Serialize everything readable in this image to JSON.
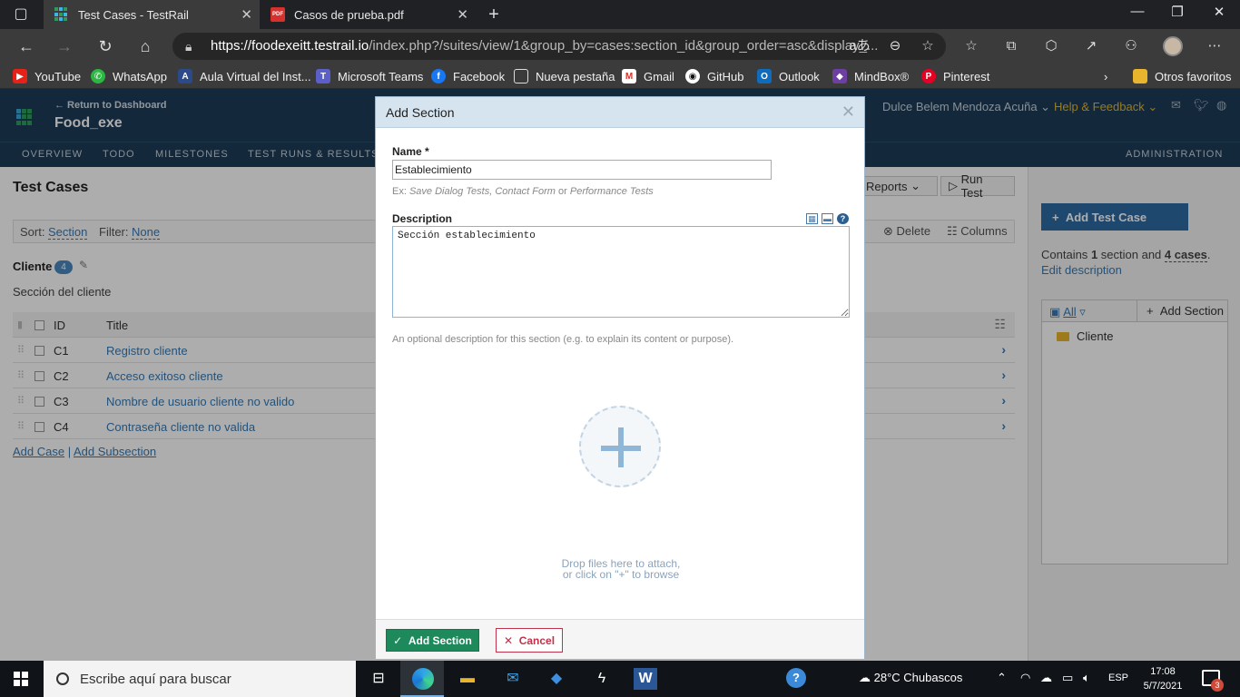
{
  "browser": {
    "tabs": [
      {
        "title": "Test Cases - TestRail",
        "active": true
      },
      {
        "title": "Casos de prueba.pdf",
        "active": false
      }
    ],
    "url_host": "https://foodexeitt.testrail.io",
    "url_path": "/index.php?/suites/view/1&group_by=cases:section_id&group_order=asc&display_...",
    "bookmarks": [
      "YouTube",
      "WhatsApp",
      "Aula Virtual del Inst...",
      "Microsoft Teams",
      "Facebook",
      "Nueva pestaña",
      "Gmail",
      "GitHub",
      "Outlook",
      "MindBox®",
      "Pinterest"
    ],
    "other_favorites": "Otros favoritos"
  },
  "header": {
    "return_link": "← Return to Dashboard",
    "project": "Food_exe",
    "user": "Dulce Belem Mendoza Acuña",
    "help": "Help & Feedback"
  },
  "nav": {
    "overview": "OVERVIEW",
    "todo": "TODO",
    "milestones": "MILESTONES",
    "test_runs": "TEST RUNS & RESULTS",
    "administration": "ADMINISTRATION"
  },
  "page": {
    "title": "Test Cases",
    "reports": "Reports",
    "run_test": "Run Test",
    "delete": "Delete",
    "columns": "Columns",
    "sort_label": "Sort:",
    "sort_value": "Section",
    "filter_label": "Filter:",
    "filter_value": "None",
    "section_name": "Cliente",
    "section_count": "4",
    "section_desc": "Sección del cliente",
    "col_id": "ID",
    "col_title": "Title",
    "cases": [
      {
        "id": "C1",
        "title": "Registro cliente"
      },
      {
        "id": "C2",
        "title": "Acceso exitoso cliente"
      },
      {
        "id": "C3",
        "title": "Nombre de usuario cliente no valido"
      },
      {
        "id": "C4",
        "title": "Contraseña cliente no valida"
      }
    ],
    "add_case": "Add Case",
    "add_subsection": "Add Subsection"
  },
  "sidebar": {
    "add_test_case": "Add Test Case",
    "contains_prefix": "Contains",
    "sections_count": "1",
    "contains_mid": "section and",
    "cases_count": "4 cases",
    "edit_description": "Edit description",
    "tree_all": "All",
    "tree_add_section": "Add Section",
    "tree_folder": "Cliente"
  },
  "modal": {
    "title": "Add Section",
    "name_label": "Name *",
    "name_value": "Establecimiento",
    "name_hint_prefix": "Ex:",
    "name_hint_examples": "Save Dialog Tests, Contact Form",
    "name_hint_or": "or",
    "name_hint_last": "Performance Tests",
    "desc_label": "Description",
    "desc_value": "Sección establecimiento",
    "desc_hint": "An optional description for this section (e.g. to explain its content or purpose).",
    "drop_line1": "Drop files here to attach,",
    "drop_line2": "or click on \"+\" to browse",
    "add_button": "Add Section",
    "cancel_button": "Cancel"
  },
  "taskbar": {
    "search_placeholder": "Escribe aquí para buscar",
    "weather": "28°C  Chubascos",
    "lang": "ESP",
    "time": "17:08",
    "date": "5/7/2021",
    "notif_count": "3"
  }
}
